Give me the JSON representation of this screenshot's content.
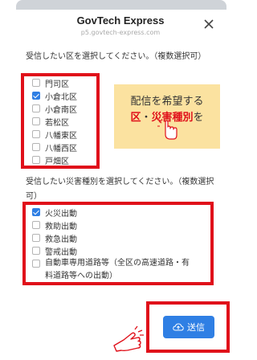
{
  "header": {
    "title": "GovTech Express",
    "url": "p5.govtech-express.com"
  },
  "ward_section": {
    "instruction": "受信したい区を選択してください。（複数選択可）",
    "options": [
      {
        "label": "門司区",
        "checked": false
      },
      {
        "label": "小倉北区",
        "checked": true
      },
      {
        "label": "小倉南区",
        "checked": false
      },
      {
        "label": "若松区",
        "checked": false
      },
      {
        "label": "八幡東区",
        "checked": false
      },
      {
        "label": "八幡西区",
        "checked": false
      },
      {
        "label": "戸畑区",
        "checked": false
      }
    ]
  },
  "callout": {
    "line1": "配信を希望する",
    "line2_part1": "区",
    "line2_part2": "・",
    "line2_part3": "災害種別",
    "line2_part4": "を"
  },
  "disaster_section": {
    "instruction": "受信したい災害種別を選択してください。（複数選択可）",
    "options": [
      {
        "label": "火災出動",
        "checked": true
      },
      {
        "label": "救助出動",
        "checked": false
      },
      {
        "label": "救急出動",
        "checked": false
      },
      {
        "label": "警戒出動",
        "checked": false
      },
      {
        "label": "自動車専用道路等（全区の高速道路・有料道路等への出動）",
        "checked": false
      }
    ]
  },
  "submit": {
    "label": "送信",
    "icon": "cloud-upload-icon"
  },
  "colors": {
    "accent": "#2f7fe4",
    "highlight": "#e0101a",
    "callout_bg": "#fbe2a0"
  }
}
